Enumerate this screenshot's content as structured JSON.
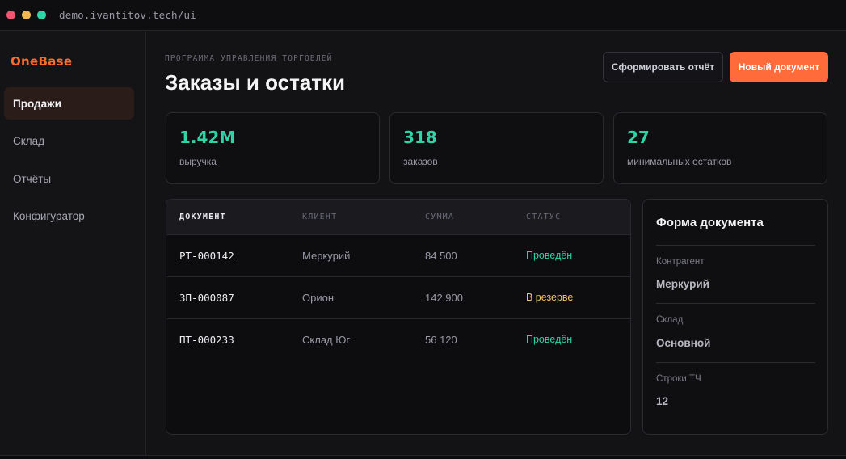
{
  "window": {
    "url": "demo.ivantitov.tech/ui"
  },
  "sidebar": {
    "logo": "OneBase",
    "items": [
      {
        "label": "Продажи",
        "active": true
      },
      {
        "label": "Склад",
        "active": false
      },
      {
        "label": "Отчёты",
        "active": false
      },
      {
        "label": "Конфигуратор",
        "active": false
      }
    ]
  },
  "header": {
    "eyebrow": "ПРОГРАММА УПРАВЛЕНИЯ ТОРГОВЛЕЙ",
    "title": "Заказы и остатки",
    "report_button": "Сформировать отчёт",
    "new_doc_button": "Новый документ"
  },
  "stats": [
    {
      "value": "1.42M",
      "label": "выручка"
    },
    {
      "value": "318",
      "label": "заказов"
    },
    {
      "value": "27",
      "label": "минимальных остатков"
    }
  ],
  "table": {
    "columns": [
      "ДОКУМЕНТ",
      "КЛИЕНТ",
      "СУММА",
      "СТАТУС"
    ],
    "rows": [
      {
        "doc": "РТ-000142",
        "client": "Меркурий",
        "sum": "84 500",
        "status": "Проведён"
      },
      {
        "doc": "ЗП-000087",
        "client": "Орион",
        "sum": "142 900",
        "status": "В резерве"
      },
      {
        "doc": "ПТ-000233",
        "client": "Склад Юг",
        "sum": "56 120",
        "status": "Проведён"
      }
    ]
  },
  "form": {
    "title": "Форма документа",
    "fields": [
      {
        "label": "Контрагент",
        "value": "Меркурий"
      },
      {
        "label": "Склад",
        "value": "Основной"
      },
      {
        "label": "Строки ТЧ",
        "value": "12"
      }
    ]
  },
  "colors": {
    "accent": "#ff6b3a",
    "positive": "#2fd3a5",
    "warning": "#f5c36a"
  }
}
